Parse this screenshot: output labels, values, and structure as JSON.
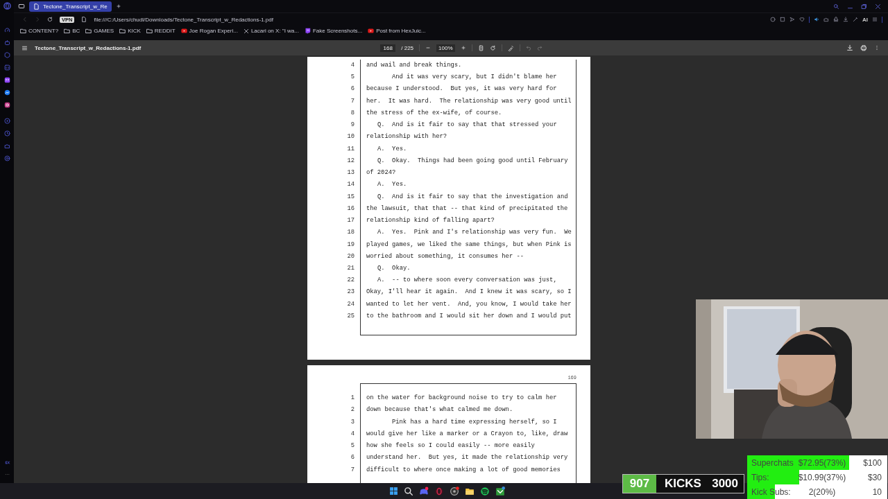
{
  "tabs": [
    {
      "label": "Tectone_Transcript_w_Re",
      "selected": true
    }
  ],
  "address_bar": {
    "badge": "VPN",
    "ai_label": "AI",
    "url": "file:///C:/Users/chudl/Downloads/Tectone_Transcript_w_Redactions-1.pdf"
  },
  "bookmarks": [
    {
      "kind": "folder",
      "label": "CONTENT?"
    },
    {
      "kind": "folder",
      "label": "BC"
    },
    {
      "kind": "folder",
      "label": "GAMES"
    },
    {
      "kind": "folder",
      "label": "KICK"
    },
    {
      "kind": "folder",
      "label": "REDDIT"
    },
    {
      "kind": "video",
      "label": "Joe Rogan Experi..."
    },
    {
      "kind": "x",
      "label": "Lacari on X: \"I wa..."
    },
    {
      "kind": "stream",
      "label": "Fake Screenshots..."
    },
    {
      "kind": "video",
      "label": "Post from HexJuic..."
    }
  ],
  "pdf_toolbar": {
    "title": "Tectone_Transcript_w_Redactions-1.pdf",
    "page": "168",
    "page_count": "/ 225",
    "zoom": "100%"
  },
  "pages": [
    {
      "lines": [
        {
          "n": "4",
          "kind": "plain",
          "text": "and wail and break things."
        },
        {
          "n": "5",
          "kind": "para",
          "text": "And it was very scary, but I didn't blame her"
        },
        {
          "n": "6",
          "kind": "plain",
          "text": "because I understood.  But yes, it was very hard for"
        },
        {
          "n": "7",
          "kind": "plain",
          "text": "her.  It was hard.  The relationship was very good until"
        },
        {
          "n": "8",
          "kind": "plain",
          "text": "the stress of the ex-wife, of course."
        },
        {
          "n": "9",
          "kind": "qa",
          "text": "Q.  And is it fair to say that that stressed your"
        },
        {
          "n": "10",
          "kind": "plain",
          "text": "relationship with her?"
        },
        {
          "n": "11",
          "kind": "qa",
          "text": "A.  Yes."
        },
        {
          "n": "12",
          "kind": "qa",
          "text": "Q.  Okay.  Things had been going good until February"
        },
        {
          "n": "13",
          "kind": "plain",
          "text": "of 2024?"
        },
        {
          "n": "14",
          "kind": "qa",
          "text": "A.  Yes."
        },
        {
          "n": "15",
          "kind": "qa",
          "text": "Q.  And is it fair to say that the investigation and"
        },
        {
          "n": "16",
          "kind": "plain",
          "text": "the lawsuit, that that -- that kind of precipitated the"
        },
        {
          "n": "17",
          "kind": "plain",
          "text": "relationship kind of falling apart?"
        },
        {
          "n": "18",
          "kind": "qa",
          "text": "A.  Yes.  Pink and I's relationship was very fun.  We"
        },
        {
          "n": "19",
          "kind": "plain",
          "text": "played games, we liked the same things, but when Pink is"
        },
        {
          "n": "20",
          "kind": "plain",
          "text": "worried about something, it consumes her --"
        },
        {
          "n": "21",
          "kind": "qa",
          "text": "Q.  Okay."
        },
        {
          "n": "22",
          "kind": "qa",
          "text": "A.  -- to where soon every conversation was just,"
        },
        {
          "n": "23",
          "kind": "plain",
          "text": "Okay, I'll hear it again.  And I knew it was scary, so I"
        },
        {
          "n": "24",
          "kind": "plain",
          "text": "wanted to let her vent.  And, you know, I would take her"
        },
        {
          "n": "25",
          "kind": "plain",
          "text": "to the bathroom and I would sit her down and I would put"
        }
      ]
    },
    {
      "page_number": "169",
      "lines": [
        {
          "n": "1",
          "kind": "plain",
          "text": "on the water for background noise to try to calm her"
        },
        {
          "n": "2",
          "kind": "plain",
          "text": "down because that's what calmed me down."
        },
        {
          "n": "3",
          "kind": "para",
          "text": "Pink has a hard time expressing herself, so I"
        },
        {
          "n": "4",
          "kind": "plain",
          "text": "would give her like a marker or a Crayon to, like, draw"
        },
        {
          "n": "5",
          "kind": "plain",
          "text": "how she feels so I could easily -- more easily"
        },
        {
          "n": "6",
          "kind": "plain",
          "text": "understand her.  But yes, it made the relationship very"
        },
        {
          "n": "7",
          "kind": "plain",
          "text": "difficult to where once making a lot of good memories"
        }
      ]
    }
  ],
  "overlay": {
    "counter": {
      "current": "907",
      "label": "KICKS",
      "goal": "3000"
    },
    "goals": [
      {
        "label": "Superchats",
        "value": "$72.95(73%)",
        "target": "$100",
        "level": 0.73
      },
      {
        "label": "Tips:",
        "value": "$10.99(37%)",
        "target": "$30",
        "level": 0.37
      },
      {
        "label": "Kick Subs:",
        "value": "2(20%)",
        "target": "10",
        "level": 0.2
      }
    ]
  }
}
